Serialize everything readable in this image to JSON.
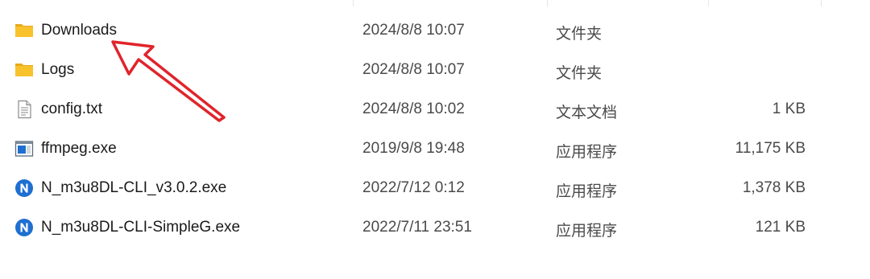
{
  "files": [
    {
      "name": "Downloads",
      "date": "2024/8/8 10:07",
      "type": "文件夹",
      "size": "",
      "icon": "folder-icon"
    },
    {
      "name": "Logs",
      "date": "2024/8/8 10:07",
      "type": "文件夹",
      "size": "",
      "icon": "folder-icon"
    },
    {
      "name": "config.txt",
      "date": "2024/8/8 10:02",
      "type": "文本文档",
      "size": "1 KB",
      "icon": "text-file-icon"
    },
    {
      "name": "ffmpeg.exe",
      "date": "2019/9/8 19:48",
      "type": "应用程序",
      "size": "11,175 KB",
      "icon": "exe-app-icon"
    },
    {
      "name": "N_m3u8DL-CLI_v3.0.2.exe",
      "date": "2022/7/12 0:12",
      "type": "应用程序",
      "size": "1,378 KB",
      "icon": "n-app-icon"
    },
    {
      "name": "N_m3u8DL-CLI-SimpleG.exe",
      "date": "2022/7/11 23:51",
      "type": "应用程序",
      "size": "121 KB",
      "icon": "n-app-icon"
    }
  ],
  "colors": {
    "folder": "#f8c22c",
    "folder_back": "#e9a91a",
    "n_icon": "#1e6fd0",
    "arrow": "#e0242b"
  },
  "annotation": {
    "icon": "red-arrow-icon"
  }
}
